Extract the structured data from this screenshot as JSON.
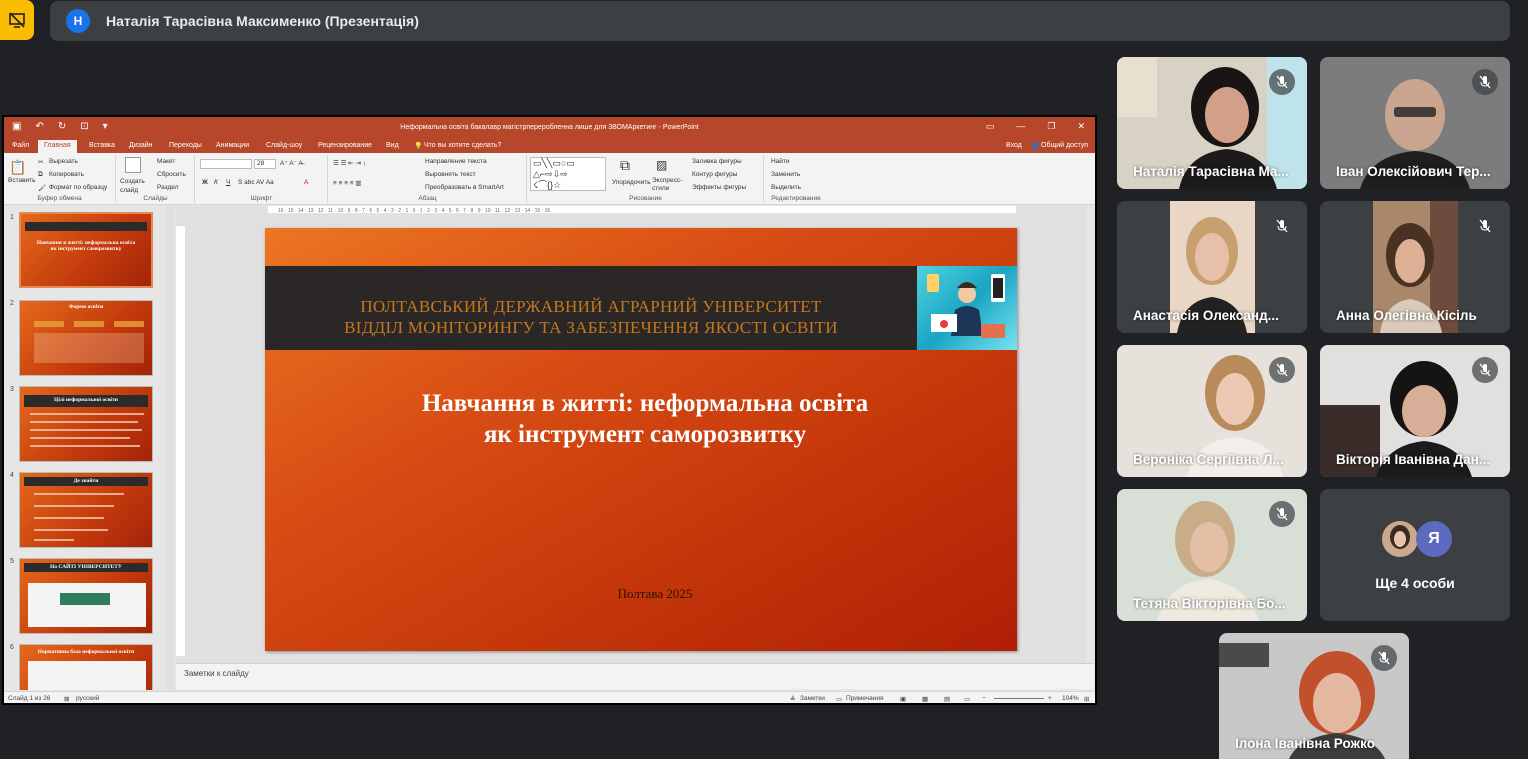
{
  "top": {
    "presenter_initial": "Н",
    "meeting_title": "Наталія Тарасівна Максименко (Презентація)"
  },
  "ppt": {
    "window_title": "Неформальна освіта бакалавр магістрпереробленна лише для 3ВОМАркетинг - PowerPoint",
    "tabs": [
      "Файл",
      "Главная",
      "Вставка",
      "Дизайн",
      "Переходы",
      "Анимации",
      "Слайд-шоу",
      "Рецензирование",
      "Вид"
    ],
    "tell_me": "Что вы хотите сделать?",
    "signin": "Вход",
    "share": "Общий доступ",
    "ribbon": {
      "paste": "Вставить",
      "cut": "Вырезать",
      "copy": "Копировать",
      "format_painter": "Формат по образцу",
      "clipboard": "Буфер обмена",
      "new_slide": "Создать слайд",
      "layout": "Макет",
      "reset": "Сбросить",
      "section": "Раздел",
      "slides": "Слайды",
      "font_group": "Шрифт",
      "font_size": "28",
      "paragraph": "Абзац",
      "text_direction": "Направление текста",
      "align_text": "Выровнять текст",
      "smartart": "Преобразовать в SmartArt",
      "arrange": "Упорядочить",
      "quick_styles": "Экспресс-стили",
      "shape_fill": "Заливка фигуры",
      "shape_outline": "Контур фигуры",
      "shape_effects": "Эффекты фигуры",
      "drawing": "Рисование",
      "find": "Найти",
      "replace": "Заменить",
      "select": "Выделить",
      "editing": "Редактирование"
    },
    "thumbnails": [
      {
        "num": "1",
        "title": "Навчання в житті: неформальна освіта як інструмент саморозвитку"
      },
      {
        "num": "2",
        "title": "Форми освіти"
      },
      {
        "num": "3",
        "title": "Цілі неформальної освіти"
      },
      {
        "num": "4",
        "title": "Де знайти"
      },
      {
        "num": "5",
        "title": "На САЙТІ УНІВЕРСИТЕТУ"
      },
      {
        "num": "6",
        "title": "Нормативна база неформальної освіти"
      }
    ],
    "slide": {
      "org_line1": "ПОЛТАВСЬКИЙ  ДЕРЖАВНИЙ АГРАРНИЙ УНІВЕРСИТЕТ",
      "org_line2": "ВІДДІЛ МОНІТОРИНГУ ТА ЗАБЕЗПЕЧЕННЯ ЯКОСТІ ОСВІТИ",
      "title_line1": "Навчання в житті: неформальна освіта",
      "title_line2": "як інструмент саморозвитку",
      "footer": "Полтава 2025"
    },
    "notes_placeholder": "Заметки к слайду",
    "status": {
      "slide_info": "Слайд 1 из 26",
      "language": "русский",
      "notes": "Заметки",
      "comments": "Примечания",
      "zoom": "104%"
    }
  },
  "participants": [
    {
      "name": "Наталія Тарасівна Ма..."
    },
    {
      "name": "Іван Олексійович Тер..."
    },
    {
      "name": "Анастасія Олександ..."
    },
    {
      "name": "Анна Олегівна Кісіль"
    },
    {
      "name": "Вероніка Сергіївна Л..."
    },
    {
      "name": "Вікторія Іванівна Дан..."
    },
    {
      "name": "Тетяна Вікторівна Бо..."
    },
    {
      "name": "Ще 4 особи",
      "avatar_letter": "Я"
    },
    {
      "name": "Ілона Іванівна Рожко"
    }
  ],
  "colors": {
    "powerpoint_accent": "#b7472a",
    "meet_background": "#202124",
    "tile_background": "#3c4043",
    "presenting_badge": "#fbbc04",
    "avatar_blue": "#1a73e8",
    "avatar_purple": "#5c6bc0"
  },
  "icons": [
    "presentation-off-icon",
    "mic-off-icon",
    "save-icon",
    "undo-icon",
    "redo-icon"
  ]
}
